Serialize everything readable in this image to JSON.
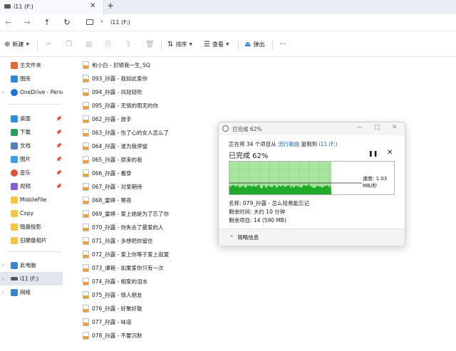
{
  "tab": {
    "title": "i11 (F:)",
    "close": "✕",
    "add": "+"
  },
  "addressbar": {
    "path": "i11 (F:)",
    "separator": "›"
  },
  "toolbar": {
    "new": "新建",
    "sort": "排序",
    "view": "查看",
    "eject": "弹出",
    "more": "···"
  },
  "nav": {
    "items": [
      {
        "label": "主文件夹",
        "icon": "home-icon",
        "color": "#e06b3a"
      },
      {
        "label": "图库",
        "icon": "gallery-icon",
        "color": "#2b87d8"
      },
      {
        "label": "OneDrive - Perso",
        "icon": "cloud-icon",
        "color": "#1e73d8"
      },
      {
        "label": "桌面",
        "icon": "desktop-icon",
        "color": "#2d8be0",
        "pinned": true
      },
      {
        "label": "下载",
        "icon": "download-icon",
        "color": "#2a9d5c",
        "pinned": true
      },
      {
        "label": "文档",
        "icon": "document-icon",
        "color": "#5b7fbd",
        "pinned": true
      },
      {
        "label": "图片",
        "icon": "picture-icon",
        "color": "#3d9ee6",
        "pinned": true
      },
      {
        "label": "音乐",
        "icon": "music-icon",
        "color": "#e0503a",
        "pinned": true
      },
      {
        "label": "视频",
        "icon": "video-icon",
        "color": "#8a5cd1",
        "pinned": true
      },
      {
        "label": "MobileFile",
        "icon": "folder-icon",
        "color": "#f5c542"
      },
      {
        "label": "Copy",
        "icon": "folder-icon",
        "color": "#f5c542"
      },
      {
        "label": "暗盘投影",
        "icon": "folder-icon",
        "color": "#f5c542"
      },
      {
        "label": "旧硬盘相片",
        "icon": "folder-icon",
        "color": "#f5c542"
      },
      {
        "label": "此电脑",
        "icon": "pc-icon",
        "color": "#3b82d0"
      },
      {
        "label": "i11 (F:)",
        "icon": "drive-icon",
        "color": "#555555"
      },
      {
        "label": "网络",
        "icon": "network-icon",
        "color": "#3b82d0"
      }
    ]
  },
  "files": [
    "前小白 - 封锁我一生_SQ",
    "093_孙露 - 我如此爱你",
    "094_孙露 - 风轻轻吹",
    "095_孙露 - 无情的雨无的你",
    "062_孙露 - 放手",
    "063_孙露 - 伤了心的女人怎么了",
    "064_孙露 - 谁为我停留",
    "065_孙露 - 原来的我",
    "066_孙露 - 看穿",
    "067_孙露 - 对爱期待",
    "068_雷婷 - 寒夜",
    "069_雷婷 - 爱上她是为了忘了你",
    "070_孙露 - 你失去了最爱的人",
    "071_孙露 - 多想把你留住",
    "072_孙露 - 爱上你等于爱上寂寞",
    "073_谭艳 - 如果爱你只有一次",
    "074_孙露 - 相爱的泪水",
    "075_孙露 - 情人朋友",
    "076_孙露 - 好聚好散",
    "077_孙露 - 味道",
    "078_孙露 - 不要沉默"
  ],
  "dialog": {
    "title": "已完成 62%",
    "line_prefix": "正在将 34 个项目从",
    "source": "流行歌曲",
    "line_mid": "复制到",
    "dest": "i11 (F:)",
    "percent_text": "已完成 62%",
    "progress": 0.62,
    "speed": "速度: 1.03 MB/秒",
    "name": "名称: 079_孙露 - 怎么轻易能忘记",
    "time_left": "剩余时间: 大约 10 分钟",
    "items_left": "剩余项目: 14 (590 MB)",
    "less_info": "简略信息",
    "pause_icon": "❚❚",
    "stop_icon": "✕"
  }
}
